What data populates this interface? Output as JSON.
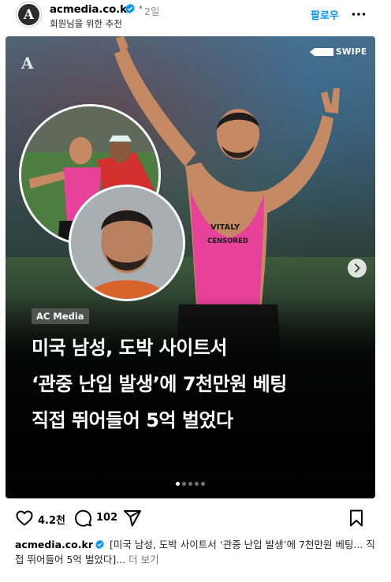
{
  "header": {
    "avatar_letter": "A",
    "username": "acmedia.co.kr",
    "dot": "•",
    "time": "2일",
    "subtitle": "회원님을 위한 추천",
    "follow_label": "팔로우"
  },
  "media": {
    "watermark": "A",
    "swipe_label": "SWIPE",
    "brand_tag": "AC Media",
    "headline": [
      "미국 남성, 도박 사이트서",
      "‘관중 난입 발생’에 7천만원 베팅",
      "직접 뛰어들어 5억 벌었다"
    ],
    "shirt_text": [
      "VITALY",
      "CENSORED"
    ],
    "page_indicator": {
      "total": 5,
      "current": 1
    }
  },
  "actions": {
    "like_count": "4.2천",
    "comment_count": "102"
  },
  "caption": {
    "username": "acmedia.co.kr",
    "text": "[미국 남성, 도박 사이트서 ‘관중 난입 발생’에 7천만원 베팅... 직접 뛰어들어 5억 벌었다]...",
    "more_label": "더 보기"
  },
  "colors": {
    "accent": "#0095f6",
    "verified": "#0095f6",
    "shirt": "#e8419a"
  }
}
